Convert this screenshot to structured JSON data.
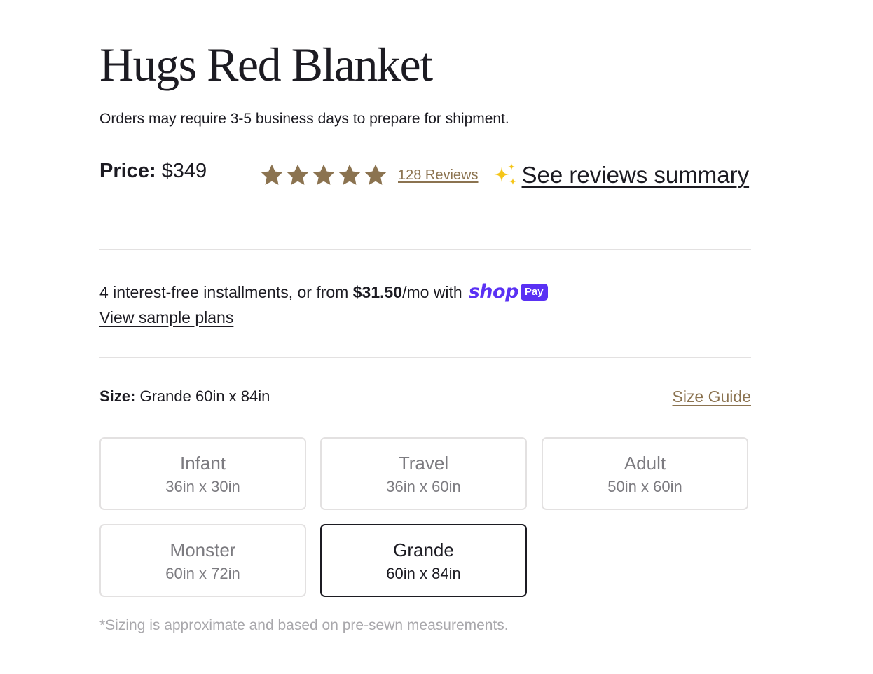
{
  "product": {
    "title": "Hugs Red Blanket",
    "shipping_notice": "Orders may require 3-5 business days to prepare for shipment.",
    "price_label": "Price:",
    "price_value": "$349"
  },
  "rating": {
    "stars": 5,
    "reviews_link": "128 Reviews",
    "summary_link": "See reviews summary",
    "star_color": "#8b7350",
    "sparkle_color": "#f5c518"
  },
  "installments": {
    "text_prefix": "4 interest-free installments, or from ",
    "amount": "$31.50",
    "text_suffix": "/mo with",
    "brand_word": "shop",
    "brand_badge": "Pay",
    "brand_color": "#5a31f4",
    "view_plans_link": "View sample plans"
  },
  "size": {
    "label": "Size:",
    "selected_value": "Grande 60in x 84in",
    "guide_link": "Size Guide",
    "options": [
      {
        "name": "Infant",
        "dimensions": "36in x 30in",
        "selected": false
      },
      {
        "name": "Travel",
        "dimensions": "36in x 60in",
        "selected": false
      },
      {
        "name": "Adult",
        "dimensions": "50in x 60in",
        "selected": false
      },
      {
        "name": "Monster",
        "dimensions": "60in x 72in",
        "selected": false
      },
      {
        "name": "Grande",
        "dimensions": "60in x 84in",
        "selected": true
      }
    ],
    "footnote": "*Sizing is approximate and based on pre-sewn measurements."
  }
}
